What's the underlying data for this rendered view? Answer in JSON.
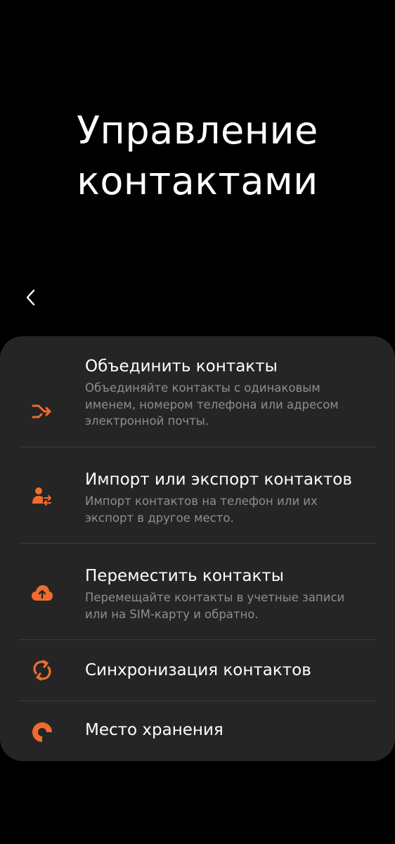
{
  "header": {
    "title_line1": "Управление",
    "title_line2": "контактами"
  },
  "accent_color": "#f26b2e",
  "items": [
    {
      "icon": "merge-icon",
      "label": "Объединить контакты",
      "desc_lines": [
        "Объединяйте контакты с одинаковым",
        "именем, номером телефона или адресом",
        "электронной почты."
      ]
    },
    {
      "icon": "import-export-icon",
      "label": "Импорт или экспорт контактов",
      "desc_lines": [
        "Импорт контактов на телефон или их",
        "экспорт в другое место."
      ]
    },
    {
      "icon": "cloud-upload-icon",
      "label": "Переместить контакты",
      "desc_lines": [
        "Перемещайте контакты в учетные записи",
        "или на SIM-карту и обратно."
      ]
    },
    {
      "icon": "sync-icon",
      "label": "Синхронизация контактов"
    },
    {
      "icon": "storage-icon",
      "label": "Место хранения"
    }
  ]
}
